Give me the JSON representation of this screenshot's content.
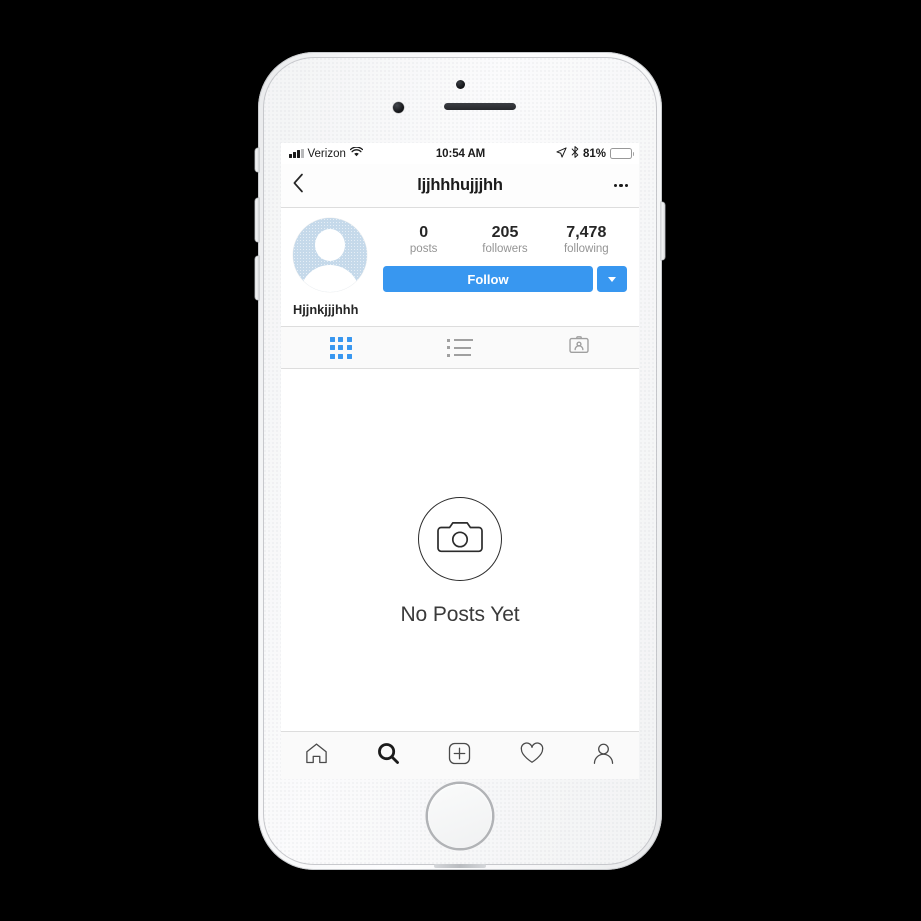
{
  "device": {
    "name": "iphone-white",
    "home_button": "home-button"
  },
  "status_bar": {
    "carrier": "Verizon",
    "wifi_icon": "wifi-icon",
    "signal_icon": "signal-bars-icon",
    "time": "10:54 AM",
    "location_icon": "location-arrow-icon",
    "bluetooth_icon": "bluetooth-icon",
    "battery_percent": "81%",
    "battery_icon": "battery-icon",
    "battery_level": 81
  },
  "nav": {
    "back_icon": "chevron-left-icon",
    "title": "ljjhhhujjjhh",
    "more_icon": "ellipsis-icon"
  },
  "profile": {
    "avatar_icon": "default-avatar-icon",
    "full_name": "Hjjnkjjjhhh",
    "stats": [
      {
        "value": "0",
        "label": "posts"
      },
      {
        "value": "205",
        "label": "followers"
      },
      {
        "value": "7,478",
        "label": "following"
      }
    ],
    "follow_label": "Follow",
    "dropdown_icon": "caret-down-icon",
    "accent_color": "#3897f0"
  },
  "tabs": [
    {
      "name": "grid",
      "icon": "grid-icon",
      "active": true
    },
    {
      "name": "list",
      "icon": "list-icon",
      "active": false
    },
    {
      "name": "tagged",
      "icon": "tagged-person-icon",
      "active": false
    }
  ],
  "empty_state": {
    "icon": "camera-icon",
    "text": "No Posts Yet"
  },
  "tabbar": [
    {
      "name": "home",
      "icon": "home-icon",
      "active": false
    },
    {
      "name": "search",
      "icon": "search-icon",
      "active": true
    },
    {
      "name": "add",
      "icon": "plus-box-icon",
      "active": false
    },
    {
      "name": "activity",
      "icon": "heart-icon",
      "active": false
    },
    {
      "name": "profile",
      "icon": "person-icon",
      "active": false
    }
  ]
}
